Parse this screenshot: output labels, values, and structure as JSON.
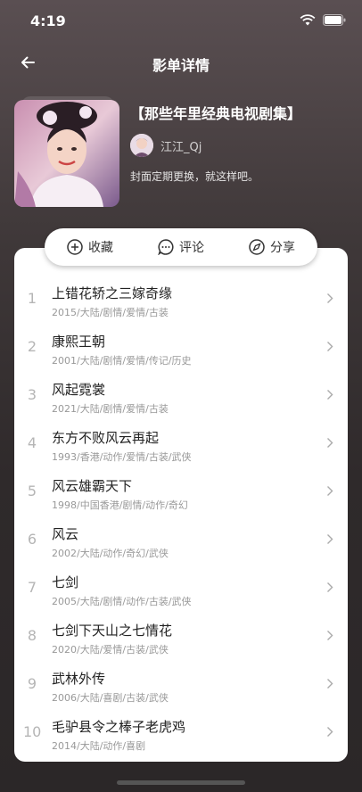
{
  "status": {
    "time": "4:19"
  },
  "nav": {
    "title": "影单详情"
  },
  "playlist": {
    "title": "【那些年里经典电视剧集】",
    "creator": "江江_Qj",
    "description": "封面定期更换，就这样吧。"
  },
  "actions": [
    {
      "label": "收藏",
      "icon": "plus-circle-icon"
    },
    {
      "label": "评论",
      "icon": "chat-bubble-icon"
    },
    {
      "label": "分享",
      "icon": "compass-icon"
    }
  ],
  "items": [
    {
      "num": "1",
      "title": "上错花轿之三嫁奇缘",
      "meta": "2015/大陆/剧情/爱情/古装"
    },
    {
      "num": "2",
      "title": "康熙王朝",
      "meta": "2001/大陆/剧情/爱情/传记/历史"
    },
    {
      "num": "3",
      "title": "风起霓裳",
      "meta": "2021/大陆/剧情/爱情/古装"
    },
    {
      "num": "4",
      "title": "东方不败风云再起",
      "meta": "1993/香港/动作/爱情/古装/武侠"
    },
    {
      "num": "5",
      "title": "风云雄霸天下",
      "meta": "1998/中国香港/剧情/动作/奇幻"
    },
    {
      "num": "6",
      "title": "风云",
      "meta": "2002/大陆/动作/奇幻/武侠"
    },
    {
      "num": "7",
      "title": "七剑",
      "meta": "2005/大陆/剧情/动作/古装/武侠"
    },
    {
      "num": "8",
      "title": "七剑下天山之七情花",
      "meta": "2020/大陆/爱情/古装/武侠"
    },
    {
      "num": "9",
      "title": "武林外传",
      "meta": "2006/大陆/喜剧/古装/武侠"
    },
    {
      "num": "10",
      "title": "毛驴县令之棒子老虎鸡",
      "meta": "2014/大陆/动作/喜剧"
    }
  ]
}
